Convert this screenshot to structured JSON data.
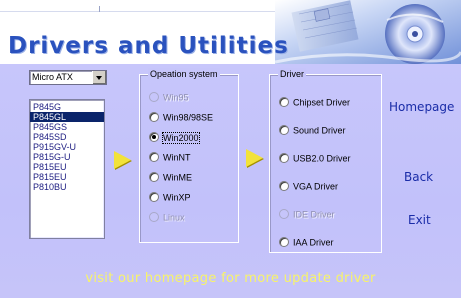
{
  "header": {
    "title": "Drivers and Utilities"
  },
  "os_select": {
    "value": "Micro ATX"
  },
  "chipset_list": {
    "items": [
      "P845G",
      "P845GL",
      "P845GS",
      "P845SD",
      "P915GV-U",
      "P815G-U",
      "P815EU",
      "P815EU",
      "P810BU"
    ],
    "selected_index": 1
  },
  "os_group": {
    "legend": "Opeation system",
    "options": [
      {
        "label": "Win95",
        "checked": false,
        "disabled": true
      },
      {
        "label": "Win98/98SE",
        "checked": false,
        "disabled": false
      },
      {
        "label": "Win2000",
        "checked": true,
        "disabled": false
      },
      {
        "label": "WinNT",
        "checked": false,
        "disabled": false
      },
      {
        "label": "WinME",
        "checked": false,
        "disabled": false
      },
      {
        "label": "WinXP",
        "checked": false,
        "disabled": false
      },
      {
        "label": "Linux",
        "checked": false,
        "disabled": true
      }
    ]
  },
  "driver_group": {
    "legend": "Driver",
    "options": [
      {
        "label": "Chipset Driver",
        "checked": false,
        "disabled": false
      },
      {
        "label": "Sound Driver",
        "checked": false,
        "disabled": false
      },
      {
        "label": "USB2.0 Driver",
        "checked": false,
        "disabled": false
      },
      {
        "label": "VGA Driver",
        "checked": false,
        "disabled": false
      },
      {
        "label": "IDE Driver",
        "checked": false,
        "disabled": true
      },
      {
        "label": "IAA Driver",
        "checked": false,
        "disabled": false
      }
    ]
  },
  "links": {
    "homepage": "Homepage",
    "back": "Back",
    "exit": "Exit"
  },
  "footer": {
    "text": "visit our homepage for more update driver"
  },
  "colors": {
    "title_blue": "#2a52be",
    "panel_lavender": "#c6c5fa",
    "arrow_yellow": "#f2e23a",
    "footer_yellow": "#f8f468",
    "link_blue": "#1a2ca8"
  }
}
